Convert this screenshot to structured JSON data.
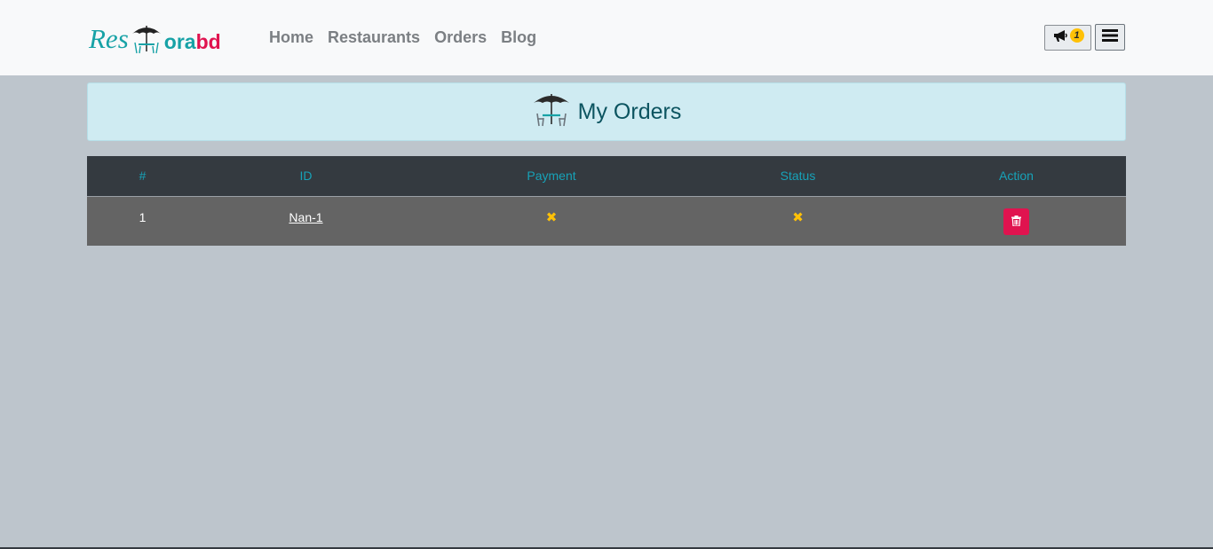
{
  "brand": {
    "part1": "Res",
    "part2": "ora",
    "part3": "bd",
    "colors": {
      "teal": "#17a2a6",
      "pink": "#e0134f"
    }
  },
  "nav": {
    "items": [
      {
        "label": "Home"
      },
      {
        "label": "Restaurants"
      },
      {
        "label": "Orders"
      },
      {
        "label": "Blog"
      }
    ]
  },
  "notifications": {
    "icon": "megaphone-icon",
    "count": "1"
  },
  "menu": {
    "icon": "hamburger-menu-icon"
  },
  "page": {
    "title": "My Orders",
    "icon": "restaurant-umbrella-icon"
  },
  "table": {
    "headers": [
      "#",
      "ID",
      "Payment",
      "Status",
      "Action"
    ],
    "rows": [
      {
        "index": "1",
        "id": "Nan-1",
        "payment": "✖",
        "status": "✖",
        "action_icon": "trash-icon"
      }
    ]
  },
  "colors": {
    "header_bg": "#343a40",
    "header_text": "#17a2b8",
    "row_bg": "#646464",
    "alert_bg": "#cfebf2",
    "delete_button": "#e0134f",
    "x_mark": "#ffc107"
  }
}
